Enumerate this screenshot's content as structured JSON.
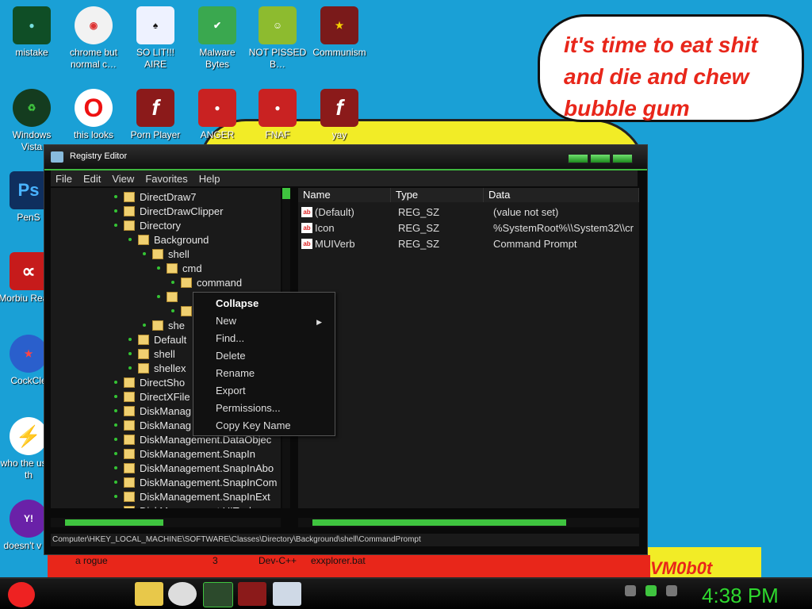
{
  "desktop": {
    "icons": [
      {
        "label": "mistake",
        "bg": "#0f4e26",
        "glyph": "●"
      },
      {
        "label": "chrome but normal c…",
        "bg": "#f2f2f2",
        "glyph": "◉"
      },
      {
        "label": "SO LIT!!! AIRE",
        "bg": "#eef2ff",
        "glyph": "♠"
      },
      {
        "label": "Malware Bytes",
        "bg": "#3aa84f",
        "glyph": "✔"
      },
      {
        "label": "NOT PISSED B…",
        "bg": "#8dbb2f",
        "glyph": "☺"
      },
      {
        "label": "Communism",
        "bg": "#7a1a1a",
        "glyph": "★"
      },
      {
        "label": "Windows Vista",
        "bg": "#143c1f",
        "glyph": "♻"
      },
      {
        "label": "this looks",
        "bg": "#ffffff",
        "glyph": "O"
      },
      {
        "label": "Porn Player",
        "bg": "#8b1a1a",
        "glyph": "f"
      },
      {
        "label": "ANGER",
        "bg": "#c92222",
        "glyph": "●"
      },
      {
        "label": "FNAF",
        "bg": "#c92222",
        "glyph": "●"
      },
      {
        "label": "yay",
        "bg": "#8b1a1a",
        "glyph": "f"
      },
      {
        "label": "PenS",
        "bg": "#0f2f5e",
        "glyph": "Ps"
      },
      {
        "label": "Morbiu Reade",
        "bg": "#c61b1b",
        "glyph": "∝"
      },
      {
        "label": "CockCle",
        "bg": "#2a5fcc",
        "glyph": "★"
      },
      {
        "label": "who the uses th",
        "bg": "#f07820",
        "glyph": "⚡"
      },
      {
        "label": "doesn't v lol",
        "bg": "#6a21a8",
        "glyph": "Y!"
      }
    ],
    "speech_bubble": "it's time to eat shit and die and chew bubble gum",
    "watermark": "VM0b0t",
    "bottom_texts": [
      "a rogue",
      "3",
      "Dev-C++",
      "exxplorer.bat"
    ]
  },
  "window": {
    "title": "Registry Editor",
    "menu": [
      "File",
      "Edit",
      "View",
      "Favorites",
      "Help"
    ],
    "tree": [
      {
        "label": "DirectDraw7",
        "indent": 0
      },
      {
        "label": "DirectDrawClipper",
        "indent": 0
      },
      {
        "label": "Directory",
        "indent": 0
      },
      {
        "label": "Background",
        "indent": 1
      },
      {
        "label": "shell",
        "indent": 2
      },
      {
        "label": "cmd",
        "indent": 3
      },
      {
        "label": "command",
        "indent": 4
      },
      {
        "label": "",
        "indent": 3
      },
      {
        "label": "",
        "indent": 4
      },
      {
        "label": "she",
        "indent": 2
      },
      {
        "label": "Default",
        "indent": 1
      },
      {
        "label": "shell",
        "indent": 1
      },
      {
        "label": "shellex",
        "indent": 1
      },
      {
        "label": "DirectSho",
        "indent": 0
      },
      {
        "label": "DirectXFile",
        "indent": 0
      },
      {
        "label": "DiskManag",
        "indent": 0
      },
      {
        "label": "DiskManag",
        "indent": 0
      },
      {
        "label": "DiskManagement.DataObjec",
        "indent": 0
      },
      {
        "label": "DiskManagement.SnapIn",
        "indent": 0
      },
      {
        "label": "DiskManagement.SnapInAbo",
        "indent": 0
      },
      {
        "label": "DiskManagement.SnapInCom",
        "indent": 0
      },
      {
        "label": "DiskManagement.SnapInExt",
        "indent": 0
      },
      {
        "label": "DiskManagement.UITasks",
        "indent": 0
      }
    ],
    "columns": [
      "Name",
      "Type",
      "Data"
    ],
    "values": [
      {
        "name": "(Default)",
        "type": "REG_SZ",
        "data": "(value not set)"
      },
      {
        "name": "Icon",
        "type": "REG_SZ",
        "data": "%SystemRoot%\\\\System32\\\\cr"
      },
      {
        "name": "MUIVerb",
        "type": "REG_SZ",
        "data": "Command Prompt"
      }
    ],
    "status": "Computer\\HKEY_LOCAL_MACHINE\\SOFTWARE\\Classes\\Directory\\Background\\shell\\CommandPrompt"
  },
  "context_menu": {
    "items": [
      "Collapse",
      "New",
      "Find...",
      "Delete",
      "Rename",
      "Export",
      "Permissions...",
      "Copy Key Name"
    ]
  },
  "taskbar": {
    "clock": "4:38 PM",
    "accent": "#2ed82e"
  }
}
